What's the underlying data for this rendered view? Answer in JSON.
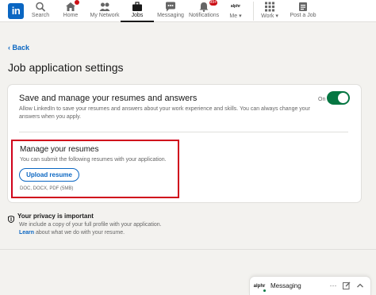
{
  "nav": {
    "logo_text": "in",
    "items": [
      {
        "label": "Search",
        "icon": "search-icon"
      },
      {
        "label": "Home",
        "icon": "home-icon",
        "badge": ""
      },
      {
        "label": "My Network",
        "icon": "network-icon"
      },
      {
        "label": "Jobs",
        "icon": "briefcase-icon"
      },
      {
        "label": "Messaging",
        "icon": "messaging-icon"
      },
      {
        "label": "Notifications",
        "icon": "bell-icon",
        "badge": "99+"
      },
      {
        "label": "Me",
        "icon": "avatar-icon",
        "avatar_text": "alphr"
      },
      {
        "label": "Work",
        "icon": "grid-icon"
      },
      {
        "label": "Post a Job",
        "icon": "post-job-icon"
      }
    ]
  },
  "back_label": "Back",
  "page_title": "Job application settings",
  "settings_card": {
    "title": "Save and manage your resumes and answers",
    "description": "Allow LinkedIn to save your resumes and answers about your work experience and skills. You can always change your answers when you apply.",
    "toggle_label": "On",
    "toggle_on": true,
    "accent_color": "#057642"
  },
  "resumes": {
    "title": "Manage your resumes",
    "description": "You can submit the following resumes with your application.",
    "upload_label": "Upload resume",
    "formats": "DOC, DOCX, PDF (5MB)",
    "highlight_color": "#d0021b"
  },
  "privacy": {
    "title": "Your privacy is important",
    "line1": "We include a copy of your full profile with your application.",
    "link": "Learn",
    "line2_rest": " about what we do with your resume."
  },
  "messaging": {
    "avatar_text": "alphr",
    "label": "Messaging"
  },
  "colors": {
    "brand": "#0a66c2",
    "background": "#f3f2ef"
  }
}
